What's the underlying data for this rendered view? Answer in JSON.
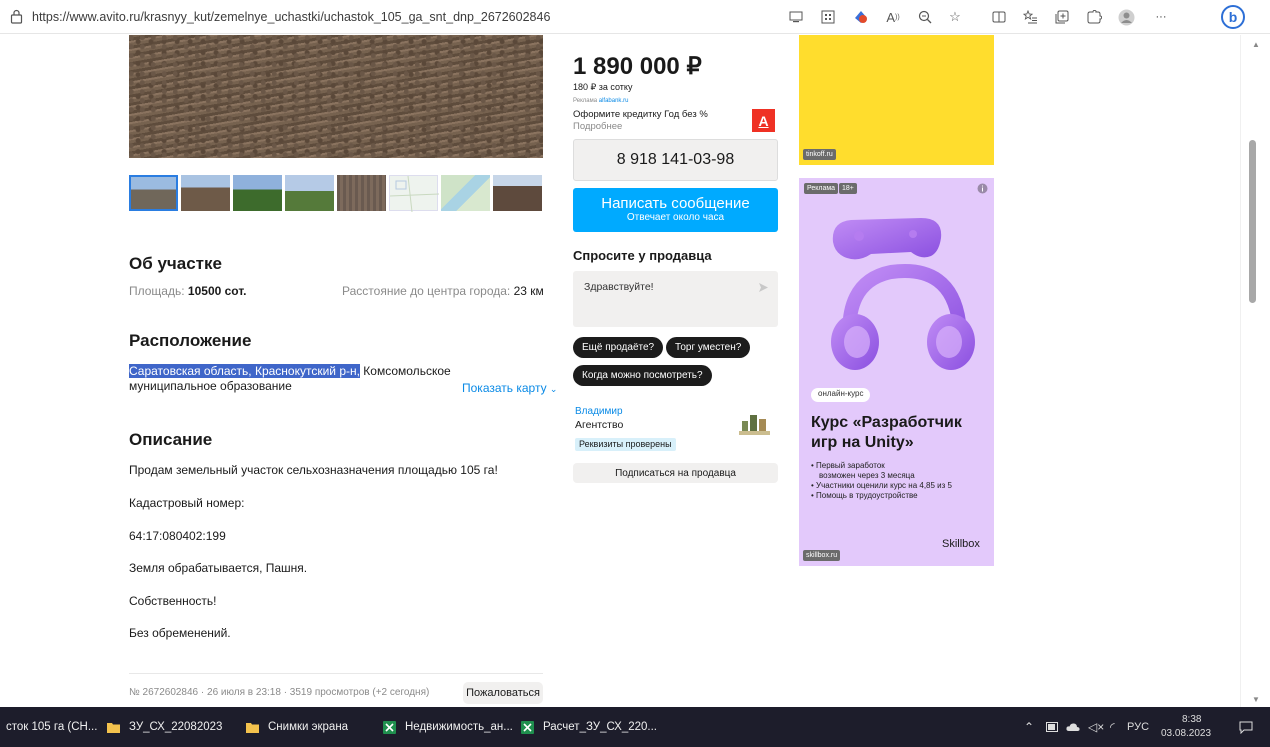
{
  "browser": {
    "url": "https://www.avito.ru/krasnyy_kut/zemelnye_uchastki/uchastok_105_ga_snt_dnp_2672602846",
    "ellipsis": "···",
    "bing_letter": "b"
  },
  "about": {
    "heading": "Об участке",
    "area_label": "Площадь:",
    "area_value": "10500 сот.",
    "distance_label": "Расстояние до центра города:",
    "distance_value": "23 км"
  },
  "location": {
    "heading": "Расположение",
    "address_selected": "Саратовская область, Краснокутский р-н,",
    "address_rest": " Комсомольское",
    "address_line2": "муниципальное образование",
    "show_map": "Показать карту"
  },
  "description": {
    "heading": "Описание",
    "lines": [
      "Продам земельный участок сельхозназначения площадью 105 га!",
      "Кадастровый номер:",
      "64:17:080402:199",
      "Земля обрабатывается, Пашня.",
      "Собственность!",
      "Без обременений."
    ]
  },
  "footer": {
    "meta": "№ 2672602846 · 26 июля в 23:18 · 3519 просмотров (+2 сегодня)",
    "report": "Пожаловаться"
  },
  "sidebar": {
    "price": "1 890 000 ₽",
    "per_sotka": "180 ₽ за сотку",
    "ad_label": "Реклама",
    "ad_source": "alfabank.ru",
    "ad_text": "Оформите кредитку Год без %",
    "ad_more": "Подробнее",
    "ad_badge": "А",
    "phone": "8 918 141-03-98",
    "write_msg": "Написать сообщение",
    "write_sub": "Отвечает около часа",
    "ask_heading": "Спросите у продавца",
    "ask_placeholder": "Здравствуйте!",
    "chips": [
      "Ещё продаёте?",
      "Торг уместен?",
      "Когда можно посмотреть?"
    ],
    "seller_name": "Владимир",
    "seller_type": "Агентство",
    "verified": "Реквизиты проверены",
    "subscribe": "Подписаться на продавца"
  },
  "ads": {
    "yellow_source": "tinkoff.ru",
    "purple_tag_ad": "Реклама",
    "purple_tag_age": "18+",
    "purple_course_tag": "онлайн-курс",
    "purple_title_1": "Курс «Разработчик",
    "purple_title_2": "игр на Unity»",
    "purple_bullets": [
      "Первый заработок",
      "возможен через 3 месяца",
      "Участники оценили курс на 4,85 из 5",
      "Помощь в трудоустройстве"
    ],
    "purple_brand": "Skillbox",
    "purple_source": "skillbox.ru"
  },
  "taskbar": {
    "items": [
      "сток 105 га (СН...",
      "ЗУ_СХ_22082023",
      "Снимки экрана",
      "Недвижимость_ан...",
      "Расчет_ЗУ_СХ_220..."
    ],
    "lang": "РУС",
    "time": "8:38",
    "date": "03.08.2023"
  }
}
